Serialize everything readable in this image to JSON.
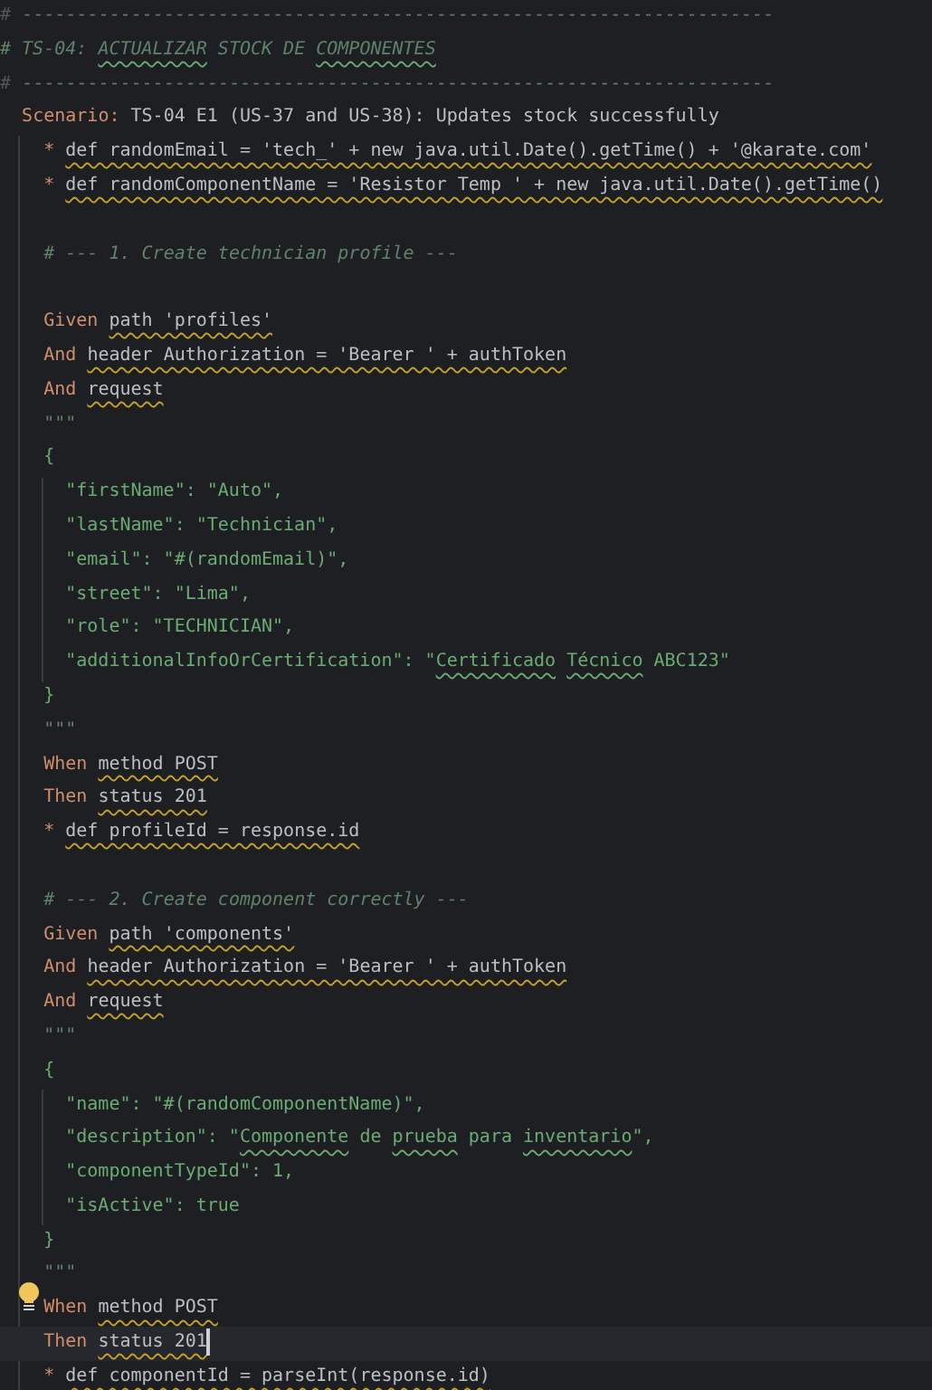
{
  "editor": {
    "lines": [
      {
        "current": false,
        "hint": false,
        "segments": [
          {
            "kind": "rule-hash",
            "text": "#"
          },
          {
            "kind": "rule",
            "text": " ---------------------------------------------------------------------"
          }
        ]
      },
      {
        "current": false,
        "hint": false,
        "segments": [
          {
            "kind": "heading",
            "text": "# TS-04: "
          },
          {
            "kind": "heading",
            "text": "ACTUALIZAR",
            "typo": true
          },
          {
            "kind": "heading",
            "text": " STOCK DE "
          },
          {
            "kind": "heading",
            "text": "COMPONENTES",
            "typo": true
          }
        ]
      },
      {
        "current": false,
        "hint": false,
        "segments": [
          {
            "kind": "rule-hash",
            "text": "#"
          },
          {
            "kind": "rule",
            "text": " ---------------------------------------------------------------------"
          }
        ]
      },
      {
        "current": false,
        "hint": false,
        "segments": [
          {
            "kind": "keyword",
            "text": "  Scenario:"
          },
          {
            "kind": "code",
            "text": " TS-04 E1 (US-37 and US-38): Updates stock successfully"
          }
        ]
      },
      {
        "current": false,
        "hint": false,
        "segments": [
          {
            "kind": "keyword",
            "text": "    * "
          },
          {
            "kind": "code",
            "text": "def randomEmail = 'tech_' + new java.util.Date().getTime() + '@karate.com'",
            "warning": true
          }
        ]
      },
      {
        "current": false,
        "hint": false,
        "segments": [
          {
            "kind": "keyword",
            "text": "    * "
          },
          {
            "kind": "code",
            "text": "def randomComponentName = 'Resistor Temp ' + new java.util.Date().getTime()",
            "warning": true
          }
        ]
      },
      {
        "current": false,
        "hint": false
      },
      {
        "current": false,
        "hint": false,
        "segments": [
          {
            "kind": "comment",
            "text": "    # --- 1. Create technician profile ---"
          }
        ]
      },
      {
        "current": false,
        "hint": false
      },
      {
        "current": false,
        "hint": false,
        "segments": [
          {
            "kind": "keyword",
            "text": "    Given "
          },
          {
            "kind": "code",
            "text": "path 'profiles'",
            "warning": true
          }
        ]
      },
      {
        "current": false,
        "hint": false,
        "segments": [
          {
            "kind": "keyword",
            "text": "    And "
          },
          {
            "kind": "code",
            "text": "header Authorization = 'Bearer ' + authToken",
            "warning": true
          }
        ]
      },
      {
        "current": false,
        "hint": false,
        "segments": [
          {
            "kind": "keyword",
            "text": "    And "
          },
          {
            "kind": "code",
            "text": "request",
            "warning": true
          }
        ]
      },
      {
        "current": false,
        "hint": false,
        "segments": [
          {
            "kind": "doc",
            "text": "    \"\"\""
          }
        ]
      },
      {
        "current": false,
        "hint": false,
        "segments": [
          {
            "kind": "string",
            "text": "    {"
          }
        ]
      },
      {
        "current": false,
        "hint": false,
        "segments": [
          {
            "kind": "string",
            "text": "      \"firstName\": \"Auto\","
          }
        ]
      },
      {
        "current": false,
        "hint": false,
        "segments": [
          {
            "kind": "string",
            "text": "      \"lastName\": \"Technician\","
          }
        ]
      },
      {
        "current": false,
        "hint": false,
        "segments": [
          {
            "kind": "string",
            "text": "      \"email\": \"#(randomEmail)\","
          }
        ]
      },
      {
        "current": false,
        "hint": false,
        "segments": [
          {
            "kind": "string",
            "text": "      \"street\": \"Lima\","
          }
        ]
      },
      {
        "current": false,
        "hint": false,
        "segments": [
          {
            "kind": "string",
            "text": "      \"role\": \"TECHNICIAN\","
          }
        ]
      },
      {
        "current": false,
        "hint": false,
        "segments": [
          {
            "kind": "string",
            "text": "      \"additionalInfoOrCertification\": \""
          },
          {
            "kind": "string",
            "text": "Certificado",
            "typo": true
          },
          {
            "kind": "string",
            "text": " Técnico",
            "typo": true
          },
          {
            "kind": "string",
            "text": " ABC123\""
          }
        ]
      },
      {
        "current": false,
        "hint": false,
        "segments": [
          {
            "kind": "string",
            "text": "    }"
          }
        ]
      },
      {
        "current": false,
        "hint": false,
        "segments": [
          {
            "kind": "doc",
            "text": "    \"\"\""
          }
        ]
      },
      {
        "current": false,
        "hint": false,
        "segments": [
          {
            "kind": "keyword",
            "text": "    When "
          },
          {
            "kind": "code",
            "text": "method POST",
            "warning": true
          }
        ]
      },
      {
        "current": false,
        "hint": false,
        "segments": [
          {
            "kind": "keyword",
            "text": "    Then "
          },
          {
            "kind": "code",
            "text": "status 201",
            "warning": true
          }
        ]
      },
      {
        "current": false,
        "hint": false,
        "segments": [
          {
            "kind": "keyword",
            "text": "    * "
          },
          {
            "kind": "code",
            "text": "def profileId = response.id",
            "warning": true
          }
        ]
      },
      {
        "current": false,
        "hint": false
      },
      {
        "current": false,
        "hint": false,
        "segments": [
          {
            "kind": "comment",
            "text": "    # --- 2. Create component correctly ---"
          }
        ]
      },
      {
        "current": false,
        "hint": false,
        "segments": [
          {
            "kind": "keyword",
            "text": "    Given "
          },
          {
            "kind": "code",
            "text": "path 'components'",
            "warning": true
          }
        ]
      },
      {
        "current": false,
        "hint": false,
        "segments": [
          {
            "kind": "keyword",
            "text": "    And "
          },
          {
            "kind": "code",
            "text": "header Authorization = 'Bearer ' + authToken",
            "warning": true
          }
        ]
      },
      {
        "current": false,
        "hint": false,
        "segments": [
          {
            "kind": "keyword",
            "text": "    And "
          },
          {
            "kind": "code",
            "text": "request",
            "warning": true
          }
        ]
      },
      {
        "current": false,
        "hint": false,
        "segments": [
          {
            "kind": "doc",
            "text": "    \"\"\""
          }
        ]
      },
      {
        "current": false,
        "hint": false,
        "segments": [
          {
            "kind": "string",
            "text": "    {"
          }
        ]
      },
      {
        "current": false,
        "hint": false,
        "segments": [
          {
            "kind": "string",
            "text": "      \"name\": \"#(randomComponentName)\","
          }
        ]
      },
      {
        "current": false,
        "hint": false,
        "segments": [
          {
            "kind": "string",
            "text": "      \"description\": \""
          },
          {
            "kind": "string",
            "text": "Componente",
            "typo": true
          },
          {
            "kind": "string",
            "text": " de "
          },
          {
            "kind": "string",
            "text": "prueba",
            "typo": true
          },
          {
            "kind": "string",
            "text": " para "
          },
          {
            "kind": "string",
            "text": "inventario",
            "typo": true
          },
          {
            "kind": "string",
            "text": "\","
          }
        ]
      },
      {
        "current": false,
        "hint": false,
        "segments": [
          {
            "kind": "string",
            "text": "      \"componentTypeId\": 1,"
          }
        ]
      },
      {
        "current": false,
        "hint": false,
        "segments": [
          {
            "kind": "string",
            "text": "      \"isActive\": true"
          }
        ]
      },
      {
        "current": false,
        "hint": false,
        "segments": [
          {
            "kind": "string",
            "text": "    }"
          }
        ]
      },
      {
        "current": false,
        "hint": false,
        "segments": [
          {
            "kind": "doc",
            "text": "    \"\"\""
          }
        ]
      },
      {
        "current": false,
        "hint": true,
        "segments": [
          {
            "kind": "keyword",
            "text": "    When "
          },
          {
            "kind": "code",
            "text": "method POST",
            "warning": true
          }
        ]
      },
      {
        "current": true,
        "hint": false,
        "segments": [
          {
            "kind": "keyword",
            "text": "    Then "
          },
          {
            "kind": "code",
            "text": "status 201",
            "warning": true
          }
        ]
      },
      {
        "current": false,
        "hint": false,
        "segments": [
          {
            "kind": "keyword",
            "text": "    * "
          },
          {
            "kind": "code",
            "text": "def componentId = parseInt(response.id)",
            "warning": true
          }
        ]
      }
    ]
  }
}
